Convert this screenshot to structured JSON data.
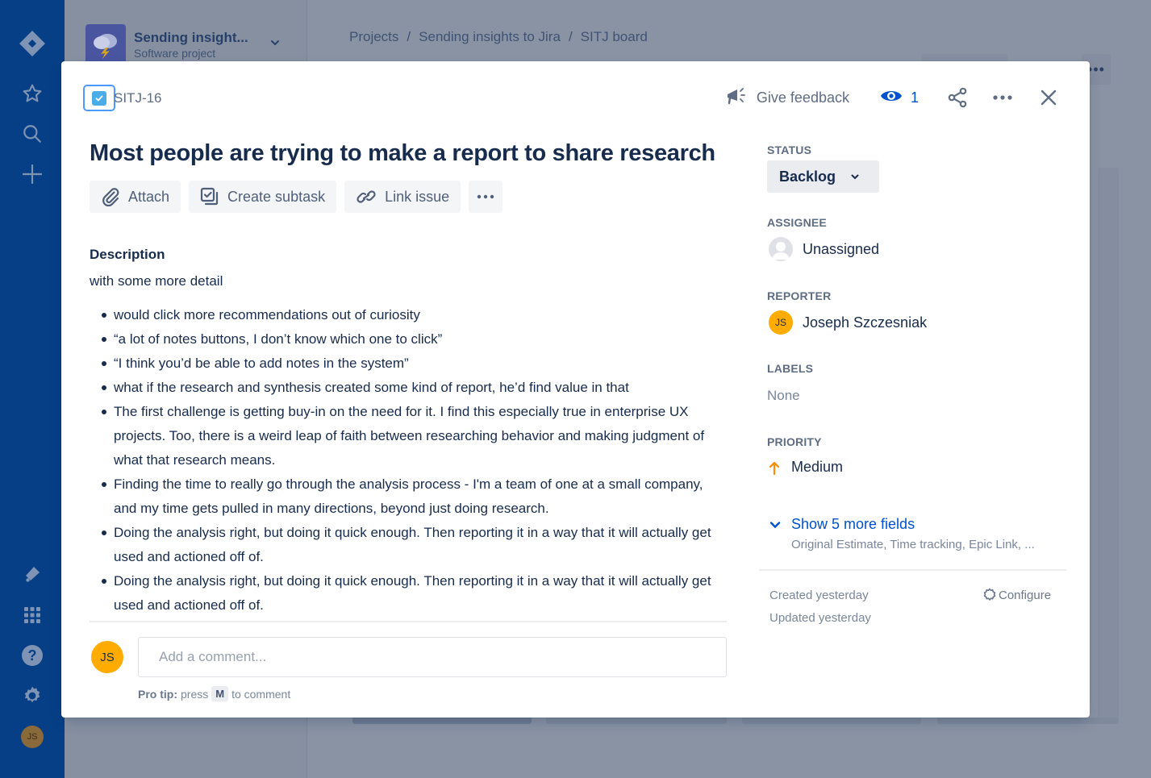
{
  "global_nav": {
    "top_icons": [
      "jira-logo-icon",
      "star-icon",
      "search-icon",
      "plus-icon"
    ],
    "bottom_icons": [
      "notifications-icon",
      "app-switcher-icon",
      "help-icon",
      "settings-icon"
    ],
    "profile_initials": "JS"
  },
  "project": {
    "name": "Sending insight...",
    "type": "Software project"
  },
  "breadcrumbs": [
    "Projects",
    "Sending insights to Jira",
    "SITJ board"
  ],
  "breadcrumb_separator": "/",
  "board_more_label": "•••",
  "issue": {
    "key": "SITJ-16",
    "type": "Task",
    "title": "Most people are trying to make a report to share research",
    "actions": {
      "attach": "Attach",
      "create_subtask": "Create subtask",
      "link_issue": "Link issue",
      "more": "•••"
    },
    "header": {
      "give_feedback": "Give feedback",
      "watchers_count": "1"
    },
    "description": {
      "heading": "Description",
      "intro": "with some more detail",
      "bullets": [
        "would click more recommendations out of curiosity",
        "“a lot of notes buttons, I don’t know which one to click”",
        "“I think you’d be able to add notes in the system”",
        "what if the research and synthesis created some kind of report, he’d find value in that",
        "The first challenge is getting buy-in on the need for it. I find this especially true in enterprise UX projects. Too, there is a weird leap of faith between researching behavior and making judgment of what that research means.",
        "Finding the time to really go through the analysis process - I'm a team of one at a small company, and my time gets pulled in many directions, beyond just doing research.",
        "Doing the analysis right, but doing it quick enough. Then reporting it in a way that it will actually get used and actioned off of.",
        "Doing the analysis right, but doing it quick enough. Then reporting it in a way that it will actually get used and actioned off of."
      ]
    },
    "comment": {
      "avatar_initials": "JS",
      "placeholder": "Add a comment...",
      "pro_tip_label": "Pro tip:",
      "pro_tip_pre": "press",
      "pro_tip_key": "M",
      "pro_tip_post": "to comment"
    },
    "fields": {
      "status_label": "STATUS",
      "status_value": "Backlog",
      "assignee_label": "ASSIGNEE",
      "assignee_value": "Unassigned",
      "reporter_label": "REPORTER",
      "reporter_value": "Joseph Szczesniak",
      "reporter_initials": "JS",
      "labels_label": "LABELS",
      "labels_value": "None",
      "priority_label": "PRIORITY",
      "priority_value": "Medium",
      "priority_color": "#ff8b00",
      "show_more": "Show 5 more fields",
      "show_more_sub": "Original Estimate, Time tracking, Epic Link, ..."
    },
    "meta": {
      "created": "Created yesterday",
      "updated": "Updated yesterday",
      "configure": "Configure"
    }
  },
  "colors": {
    "nav_bg": "#063f86",
    "accent": "#0052cc",
    "issue_type": "#4bade8",
    "avatar": "#ffab00"
  }
}
